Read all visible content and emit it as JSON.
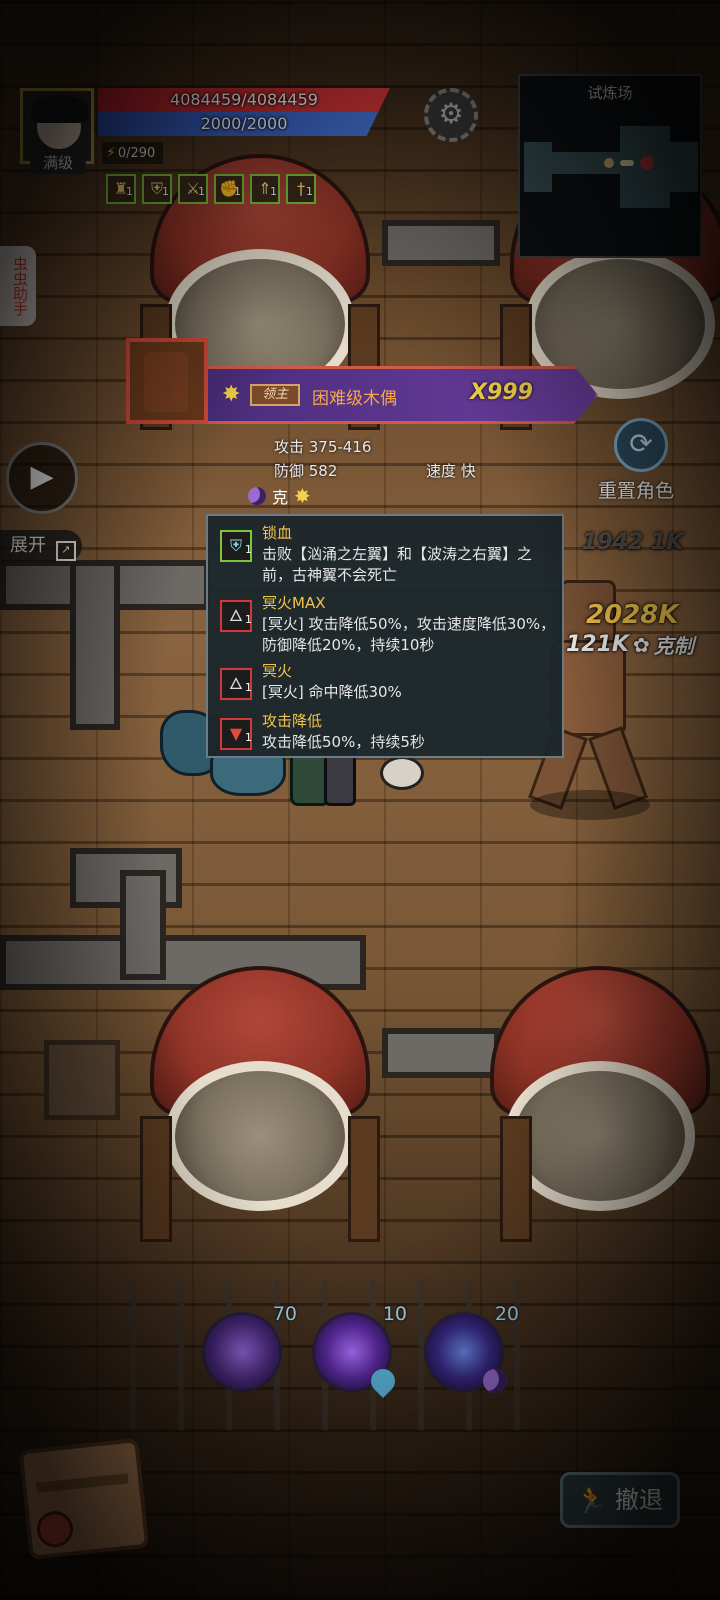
{
  "player": {
    "hp": "4084459/4084459",
    "mp": "2000/2000",
    "level_label": "满级",
    "energy": "0/290",
    "hp_color": "#e03a3a",
    "mp_color": "#4a78e0",
    "buff_icons": [
      {
        "icon": "idol-icon",
        "count": "1"
      },
      {
        "icon": "shield-badge-icon",
        "count": "1"
      },
      {
        "icon": "crossed-swords-icon",
        "count": "1"
      },
      {
        "icon": "fist-icon",
        "count": "1"
      },
      {
        "icon": "rank-up-icon",
        "count": "1"
      },
      {
        "icon": "sword-icon",
        "count": "1"
      }
    ]
  },
  "minimap": {
    "title": "试炼场"
  },
  "side_helper": {
    "label": "虫虫助手"
  },
  "controls": {
    "expand_label": "展开",
    "reset_label": "重置角色",
    "retreat_label": "撤退"
  },
  "boss": {
    "tag": "领主",
    "name": "困难级木偶",
    "multiplier": "X999",
    "attack": "攻击 375-416",
    "defense": "防御 582",
    "speed": "速度 快",
    "counter_label": "克"
  },
  "tooltip": {
    "effects": [
      {
        "name": "锁血",
        "desc": "击败【汹涌之左翼】和【波涛之右翼】之前，古神翼不会死亡",
        "icon": "shield-lock-icon",
        "count": "1",
        "border": "#7cc63d"
      },
      {
        "name": "冥火MAX",
        "desc": "[冥火] 攻击降低50%，攻击速度降低30%，防御降低20%，持续10秒",
        "icon": "wolf-flame-icon",
        "count": "1",
        "border": "#d0383a"
      },
      {
        "name": "冥火",
        "desc": "[冥火] 命中降低30%",
        "icon": "wolf-flame-icon",
        "count": "1",
        "border": "#d0383a"
      },
      {
        "name": "攻击降低",
        "desc": "攻击降低50%，持续5秒",
        "icon": "attack-down-icon",
        "count": "1",
        "border": "#d0383a"
      }
    ]
  },
  "combat_text": {
    "top": "1942 1K",
    "big": "2028K",
    "sub": "121K",
    "counter": "克制"
  },
  "skills": [
    {
      "cost": "70",
      "element": "none"
    },
    {
      "cost": "10",
      "element": "water"
    },
    {
      "cost": "20",
      "element": "dark"
    }
  ]
}
